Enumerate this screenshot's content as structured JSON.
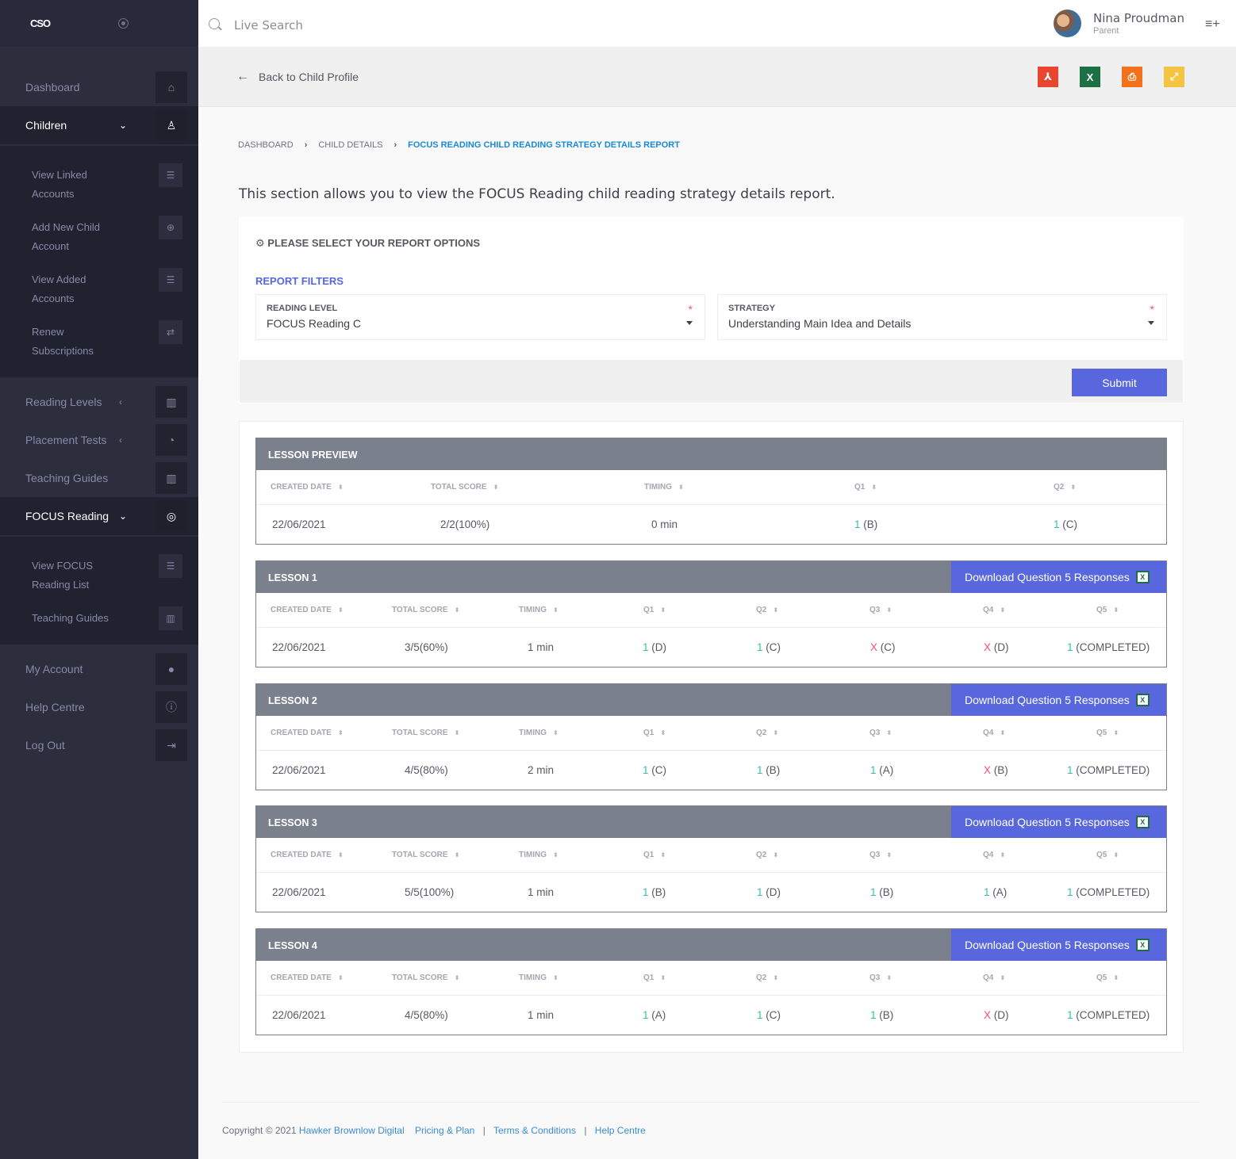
{
  "brand": {
    "logo": "CSO"
  },
  "sidebar": {
    "main": [
      {
        "label": "Dashboard",
        "icon": "home-icon"
      },
      {
        "label": "Children",
        "icon": "child-icon"
      }
    ],
    "children_sub": [
      {
        "label": "View Linked Accounts",
        "icon": "list-icon"
      },
      {
        "label": "Add New Child Account",
        "icon": "plus-circle-icon"
      },
      {
        "label": "View Added Accounts",
        "icon": "list-icon"
      },
      {
        "label": "Renew Subscriptions",
        "icon": "repeat-icon"
      }
    ],
    "mid": [
      {
        "label": "Reading Levels",
        "icon": "book-icon"
      },
      {
        "label": "Placement Tests",
        "icon": "gauge-icon"
      },
      {
        "label": "Teaching Guides",
        "icon": "library-icon"
      },
      {
        "label": "FOCUS Reading",
        "icon": "target-icon"
      }
    ],
    "focus_sub": [
      {
        "label": "View FOCUS Reading List",
        "icon": "list-icon"
      },
      {
        "label": "Teaching Guides",
        "icon": "library-icon"
      }
    ],
    "bottom": [
      {
        "label": "My Account",
        "icon": "user-icon"
      },
      {
        "label": "Help Centre",
        "icon": "info-icon"
      },
      {
        "label": "Log Out",
        "icon": "logout-icon"
      }
    ]
  },
  "topbar": {
    "search_placeholder": "Live Search",
    "user_name": "Nina Proudman",
    "user_role": "Parent"
  },
  "subheader": {
    "back_label": "Back to Child Profile",
    "exports": [
      {
        "name": "pdf-export-icon",
        "color": "#e8462f"
      },
      {
        "name": "excel-export-icon",
        "color": "#1d7044"
      },
      {
        "name": "print-icon",
        "color": "#f2711c"
      },
      {
        "name": "expand-icon",
        "color": "#f5c542"
      }
    ]
  },
  "breadcrumb": {
    "items": [
      "DASHBOARD",
      "CHILD DETAILS"
    ],
    "current": "FOCUS READING CHILD READING STRATEGY DETAILS REPORT"
  },
  "intro": "This section allows you to view the FOCUS Reading child reading strategy details report.",
  "options": {
    "title": "PLEASE SELECT YOUR REPORT OPTIONS",
    "filters_title": "REPORT FILTERS",
    "reading_level_label": "READING LEVEL",
    "reading_level_value": "FOCUS Reading C",
    "strategy_label": "STRATEGY",
    "strategy_value": "Understanding Main Idea and Details",
    "required_mark": "*",
    "submit_label": "Submit"
  },
  "download_label": "Download Question 5 Responses",
  "lessons": [
    {
      "title": "LESSON PREVIEW",
      "headers": [
        "CREATED DATE",
        "TOTAL SCORE",
        "TIMING",
        "Q1",
        "Q2"
      ],
      "row": {
        "date": "22/06/2021",
        "score": "2/2(100%)",
        "timing": "0 min",
        "answers": [
          {
            "mark": "1",
            "ok": true,
            "text": "(B)"
          },
          {
            "mark": "1",
            "ok": true,
            "text": "(C)"
          }
        ]
      }
    },
    {
      "title": "LESSON 1",
      "headers": [
        "CREATED DATE",
        "TOTAL SCORE",
        "TIMING",
        "Q1",
        "Q2",
        "Q3",
        "Q4",
        "Q5"
      ],
      "row": {
        "date": "22/06/2021",
        "score": "3/5(60%)",
        "timing": "1 min",
        "answers": [
          {
            "mark": "1",
            "ok": true,
            "text": "(D)"
          },
          {
            "mark": "1",
            "ok": true,
            "text": "(C)"
          },
          {
            "mark": "X",
            "ok": false,
            "text": "(C)"
          },
          {
            "mark": "X",
            "ok": false,
            "text": "(D)"
          },
          {
            "mark": "1",
            "ok": true,
            "text": "(COMPLETED)"
          }
        ]
      }
    },
    {
      "title": "LESSON 2",
      "headers": [
        "CREATED DATE",
        "TOTAL SCORE",
        "TIMING",
        "Q1",
        "Q2",
        "Q3",
        "Q4",
        "Q5"
      ],
      "row": {
        "date": "22/06/2021",
        "score": "4/5(80%)",
        "timing": "2 min",
        "answers": [
          {
            "mark": "1",
            "ok": true,
            "text": "(C)"
          },
          {
            "mark": "1",
            "ok": true,
            "text": "(B)"
          },
          {
            "mark": "1",
            "ok": true,
            "text": "(A)"
          },
          {
            "mark": "X",
            "ok": false,
            "text": "(B)"
          },
          {
            "mark": "1",
            "ok": true,
            "text": "(COMPLETED)"
          }
        ]
      }
    },
    {
      "title": "LESSON 3",
      "headers": [
        "CREATED DATE",
        "TOTAL SCORE",
        "TIMING",
        "Q1",
        "Q2",
        "Q3",
        "Q4",
        "Q5"
      ],
      "row": {
        "date": "22/06/2021",
        "score": "5/5(100%)",
        "timing": "1 min",
        "answers": [
          {
            "mark": "1",
            "ok": true,
            "text": "(B)"
          },
          {
            "mark": "1",
            "ok": true,
            "text": "(D)"
          },
          {
            "mark": "1",
            "ok": true,
            "text": "(B)"
          },
          {
            "mark": "1",
            "ok": true,
            "text": "(A)"
          },
          {
            "mark": "1",
            "ok": true,
            "text": "(COMPLETED)"
          }
        ]
      }
    },
    {
      "title": "LESSON 4",
      "headers": [
        "CREATED DATE",
        "TOTAL SCORE",
        "TIMING",
        "Q1",
        "Q2",
        "Q3",
        "Q4",
        "Q5"
      ],
      "row": {
        "date": "22/06/2021",
        "score": "4/5(80%)",
        "timing": "1 min",
        "answers": [
          {
            "mark": "1",
            "ok": true,
            "text": "(A)"
          },
          {
            "mark": "1",
            "ok": true,
            "text": "(C)"
          },
          {
            "mark": "1",
            "ok": true,
            "text": "(B)"
          },
          {
            "mark": "X",
            "ok": false,
            "text": "(D)"
          },
          {
            "mark": "1",
            "ok": true,
            "text": "(COMPLETED)"
          }
        ]
      }
    }
  ],
  "footer": {
    "copyright": "Copyright © 2021",
    "company": "Hawker Brownlow Digital",
    "links": [
      "Pricing & Plan",
      "Terms & Conditions",
      "Help Centre"
    ]
  }
}
